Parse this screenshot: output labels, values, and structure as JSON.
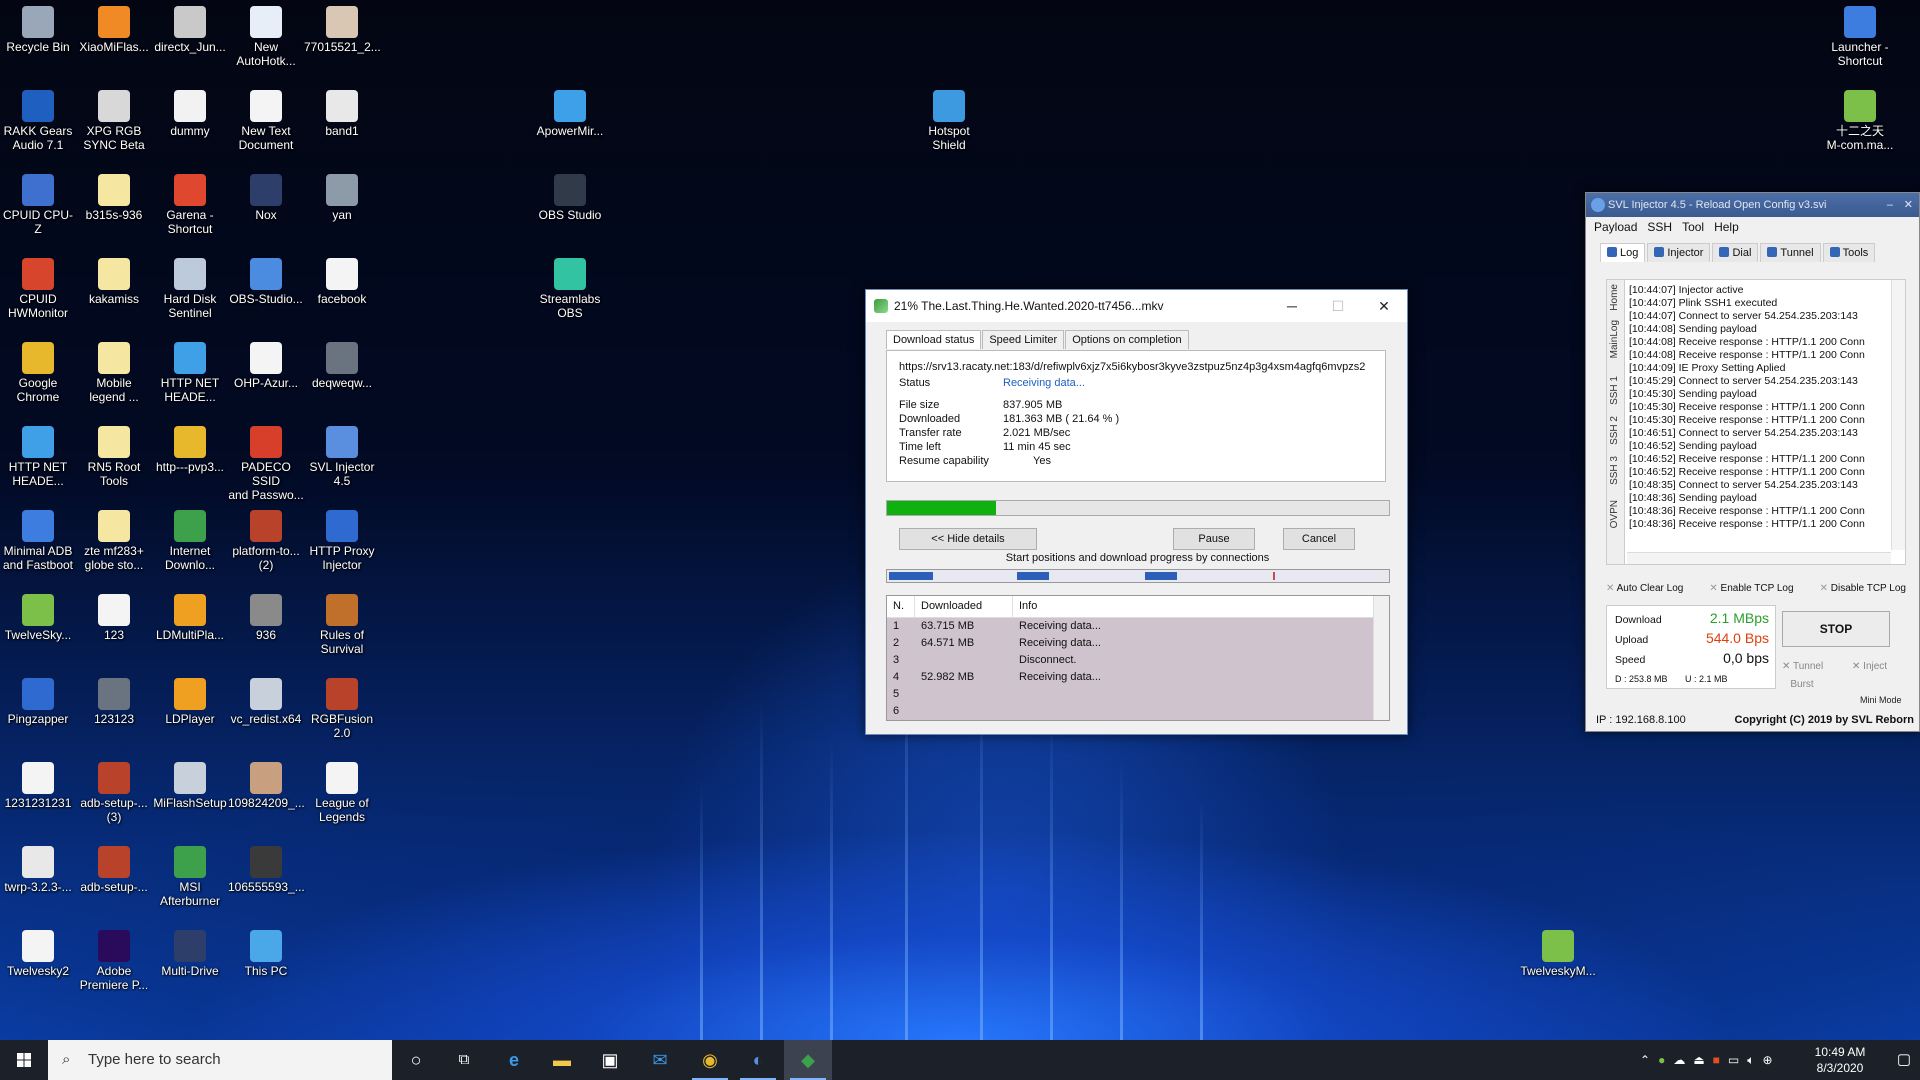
{
  "desktop": {
    "icons": [
      {
        "label": "Recycle Bin",
        "color": "#9aa7b8"
      },
      {
        "label": "XiaoMiFlas...",
        "color": "#f08a24"
      },
      {
        "label": "directx_Jun...",
        "color": "#c9c9c9"
      },
      {
        "label": "New\nAutoHotk...",
        "color": "#e8eef8"
      },
      {
        "label": "77015521_2...",
        "color": "#d9c7b4"
      },
      {
        "label": "RAKK Gears\nAudio 7.1",
        "color": "#1e5fbf"
      },
      {
        "label": "XPG RGB\nSYNC Beta",
        "color": "#d8d8d8"
      },
      {
        "label": "dummy",
        "color": "#f2f2f2"
      },
      {
        "label": "New Text\nDocument",
        "color": "#f4f4f4"
      },
      {
        "label": "band1",
        "color": "#e8e8e8"
      },
      {
        "label": "CPUID CPU-Z",
        "color": "#3f6fcf"
      },
      {
        "label": "b315s-936",
        "color": "#f5e7a1"
      },
      {
        "label": "Garena -\nShortcut",
        "color": "#e0472f"
      },
      {
        "label": "Nox",
        "color": "#2c3e69"
      },
      {
        "label": "yan",
        "color": "#8d9aa8"
      },
      {
        "label": "CPUID\nHWMonitor",
        "color": "#d8452d"
      },
      {
        "label": "kakamiss",
        "color": "#f5e7a1"
      },
      {
        "label": "Hard Disk\nSentinel",
        "color": "#bccadc"
      },
      {
        "label": "OBS-Studio...",
        "color": "#4b8be0"
      },
      {
        "label": "facebook",
        "color": "#f4f4f4"
      },
      {
        "label": "Google\nChrome",
        "color": "#e8b82c"
      },
      {
        "label": "Mobile\nlegend ...",
        "color": "#f5e7a1"
      },
      {
        "label": "HTTP NET\nHEADE...",
        "color": "#3fa0e8"
      },
      {
        "label": "OHP-Azur...",
        "color": "#f4f4f4"
      },
      {
        "label": "deqweqw...",
        "color": "#6a7480"
      },
      {
        "label": "HTTP NET\nHEADE...",
        "color": "#3fa0e8"
      },
      {
        "label": "RN5 Root\nTools",
        "color": "#f5e7a1"
      },
      {
        "label": "http---pvp3...",
        "color": "#e8b82c"
      },
      {
        "label": "PADECO SSID\nand Passwo...",
        "color": "#d83f2a"
      },
      {
        "label": "SVL Injector\n4.5",
        "color": "#5a8fe0"
      },
      {
        "label": "Minimal ADB\nand Fastboot",
        "color": "#3d7de0"
      },
      {
        "label": "zte mf283+\nglobe sto...",
        "color": "#f5e7a1"
      },
      {
        "label": "Internet\nDownlo...",
        "color": "#3da04a"
      },
      {
        "label": "platform-to...\n(2)",
        "color": "#b8422a"
      },
      {
        "label": "HTTP Proxy\nInjector",
        "color": "#2f6ad0"
      },
      {
        "label": "TwelveSky...",
        "color": "#7cc04a"
      },
      {
        "label": "123",
        "color": "#f4f4f4"
      },
      {
        "label": "LDMultiPla...",
        "color": "#f0a020"
      },
      {
        "label": "936",
        "color": "#8a8a8a"
      },
      {
        "label": "Rules of\nSurvival",
        "color": "#c0702a"
      },
      {
        "label": "Pingzapper",
        "color": "#2f6ad0"
      },
      {
        "label": "123123",
        "color": "#6a7480"
      },
      {
        "label": "LDPlayer",
        "color": "#f0a020"
      },
      {
        "label": "vc_redist.x64",
        "color": "#c8d0dc"
      },
      {
        "label": "RGBFusion\n2.0",
        "color": "#b8422a"
      },
      {
        "label": "1231231231",
        "color": "#f4f4f4"
      },
      {
        "label": "adb-setup-...\n(3)",
        "color": "#b8422a"
      },
      {
        "label": "MiFlashSetup",
        "color": "#c8d0dc"
      },
      {
        "label": "109824209_...",
        "color": "#c8a080"
      },
      {
        "label": "League of\nLegends",
        "color": "#f4f4f4"
      },
      {
        "label": "twrp-3.2.3-...",
        "color": "#e8e8e8"
      },
      {
        "label": "adb-setup-...",
        "color": "#b8422a"
      },
      {
        "label": "MSI\nAfterburner",
        "color": "#3da04a"
      },
      {
        "label": "106555593_...",
        "color": "#3a3a3a"
      },
      {
        "label": "Twelvesky2",
        "color": "#f4f4f4"
      },
      {
        "label": "Adobe\nPremiere P...",
        "color": "#2a0a5a"
      },
      {
        "label": "Multi-Drive",
        "color": "#2c3e69"
      },
      {
        "label": "This PC",
        "color": "#4ba8e8"
      },
      {
        "label": "ApowerMir...",
        "color": "#3da0e8"
      },
      {
        "label": "OBS Studio",
        "color": "#303a48"
      },
      {
        "label": "Streamlabs\nOBS",
        "color": "#31c3a2"
      },
      {
        "label": "Hotspot\nShield",
        "color": "#3d9ae0"
      },
      {
        "label": "Launcher -\nShortcut",
        "color": "#3d7de0"
      },
      {
        "label": "十二之天\nM-com.ma...",
        "color": "#7cc04a"
      },
      {
        "label": "TwelveskyM...",
        "color": "#7cc04a"
      }
    ]
  },
  "idm": {
    "title": "21% The.Last.Thing.He.Wanted.2020-tt7456...mkv",
    "tabs": [
      "Download status",
      "Speed Limiter",
      "Options on completion"
    ],
    "url": "https://srv13.racaty.net:183/d/refiwplv6xjz7x5i6kybosr3kyve3zstpuz5nz4p3g4xsm4agfq6mvpzs2",
    "status_label": "Status",
    "status_value": "Receiving data...",
    "file_size_label": "File size",
    "file_size": "837.905  MB",
    "downloaded_label": "Downloaded",
    "downloaded": "181.363  MB  ( 21.64 % )",
    "transfer_rate_label": "Transfer rate",
    "transfer_rate": "2.021  MB/sec",
    "time_left_label": "Time left",
    "time_left": "11 min 45 sec",
    "resume_label": "Resume capability",
    "resume": "Yes",
    "progress_percent": 21.64,
    "hide_details": "<< Hide details",
    "pause": "Pause",
    "cancel": "Cancel",
    "connections_label": "Start positions and download progress by connections",
    "connections_columns": [
      "N.",
      "Downloaded",
      "Info"
    ],
    "connections": [
      {
        "n": "1",
        "downloaded": "63.715  MB",
        "info": "Receiving data..."
      },
      {
        "n": "2",
        "downloaded": "64.571  MB",
        "info": "Receiving data..."
      },
      {
        "n": "3",
        "downloaded": "",
        "info": "Disconnect."
      },
      {
        "n": "4",
        "downloaded": "52.982  MB",
        "info": "Receiving data..."
      },
      {
        "n": "5",
        "downloaded": "",
        "info": ""
      },
      {
        "n": "6",
        "downloaded": "",
        "info": ""
      }
    ]
  },
  "svl": {
    "title": "SVL Injector 4.5 - Reload Open Config v3.svi",
    "menu": [
      "Payload",
      "SSH",
      "Tool",
      "Help"
    ],
    "tabs": [
      "Log",
      "Injector",
      "Dial",
      "Tunnel",
      "Tools"
    ],
    "side_tabs": [
      "Home",
      "MainLog",
      "SSH 1",
      "SSH 2",
      "SSH 3",
      "OVPN"
    ],
    "log": [
      "[10:44:07] Injector active",
      "[10:44:07] Plink SSH1 executed",
      "[10:44:07] Connect to server 54.254.235.203:143",
      "[10:44:08] Sending payload",
      "[10:44:08] Receive response : HTTP/1.1 200 Conn",
      "[10:44:08] Receive response : HTTP/1.1 200 Conn",
      "[10:44:09] IE Proxy Setting Aplied",
      "[10:45:29] Connect to server 54.254.235.203:143",
      "[10:45:30] Sending payload",
      "[10:45:30] Receive response : HTTP/1.1 200 Conn",
      "[10:45:30] Receive response : HTTP/1.1 200 Conn",
      "[10:46:51] Connect to server 54.254.235.203:143",
      "[10:46:52] Sending payload",
      "[10:46:52] Receive response : HTTP/1.1 200 Conn",
      "[10:46:52] Receive response : HTTP/1.1 200 Conn",
      "[10:48:35] Connect to server 54.254.235.203:143",
      "[10:48:36] Sending payload",
      "[10:48:36] Receive response : HTTP/1.1 200 Conn",
      "[10:48:36] Receive response : HTTP/1.1 200 Conn"
    ],
    "options": [
      "Auto Clear Log",
      "Enable TCP Log",
      "Disable TCP Log"
    ],
    "download_label": "Download",
    "download_value": "2.1 MBps",
    "download_color": "#2aa02a",
    "upload_label": "Upload",
    "upload_value": "544.0 Bps",
    "upload_color": "#e04010",
    "speed_label": "Speed",
    "speed_value": "0,0 bps",
    "d_total": "D :  253.8 MB",
    "u_total": "U :    2.1 MB",
    "stop": "STOP",
    "tunnel": "Tunnel",
    "inject": "Inject",
    "burst": "Burst",
    "mini_mode": "Mini Mode",
    "ip": "IP : 192.168.8.100",
    "copyright": "Copyright (C) 2019 by SVL Reborn"
  },
  "taskbar": {
    "search_placeholder": "Type here to search",
    "time": "10:49 AM",
    "date": "8/3/2020"
  }
}
